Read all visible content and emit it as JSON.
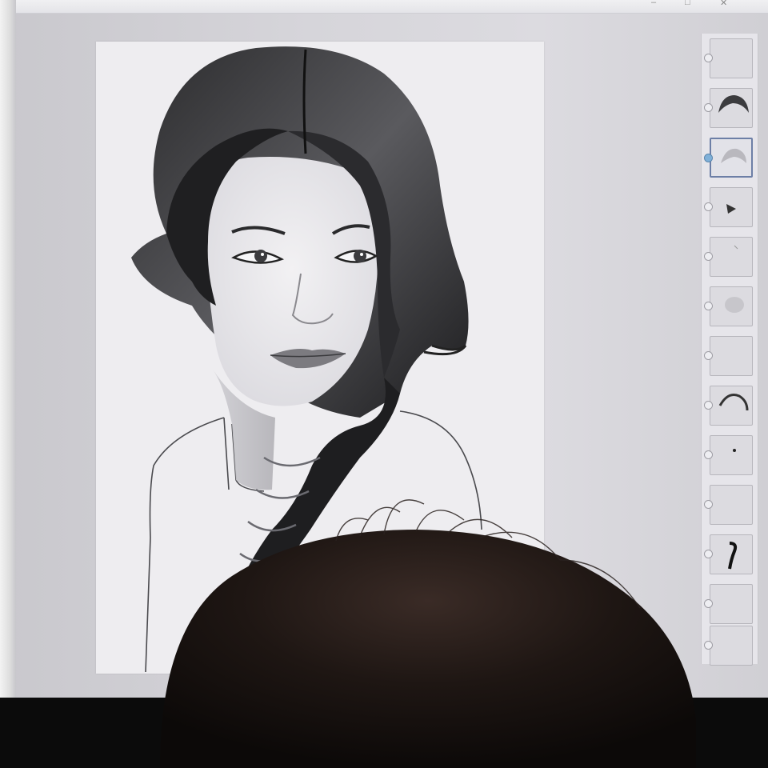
{
  "app": {
    "title": "",
    "window_controls": [
      "–",
      "□",
      "✕"
    ]
  },
  "canvas": {
    "subject": "",
    "background_color": "#eeedf0"
  },
  "layers_panel": {
    "selected_index": 2,
    "layers": [
      {
        "thumb": "blank-thumb-icon"
      },
      {
        "thumb": "hair-top-thumb-icon"
      },
      {
        "thumb": "hair-light-thumb-icon"
      },
      {
        "thumb": "eye-detail-thumb-icon"
      },
      {
        "thumb": "faint-marks-thumb-icon"
      },
      {
        "thumb": "skin-shade-thumb-icon"
      },
      {
        "thumb": "blank-thumb-icon"
      },
      {
        "thumb": "hair-strokes-thumb-icon"
      },
      {
        "thumb": "dot-thumb-icon"
      },
      {
        "thumb": "blank-thumb-icon"
      },
      {
        "thumb": "braid-thumb-icon"
      },
      {
        "thumb": "blank-thumb-icon"
      },
      {
        "thumb": "blank-thumb-icon"
      }
    ]
  },
  "colors": {
    "screen_bg": "#d6d5da",
    "canvas_bg": "#eeedf0",
    "selected_layer_border": "#6d7fa6",
    "selected_dot": "#7fb0d8"
  }
}
